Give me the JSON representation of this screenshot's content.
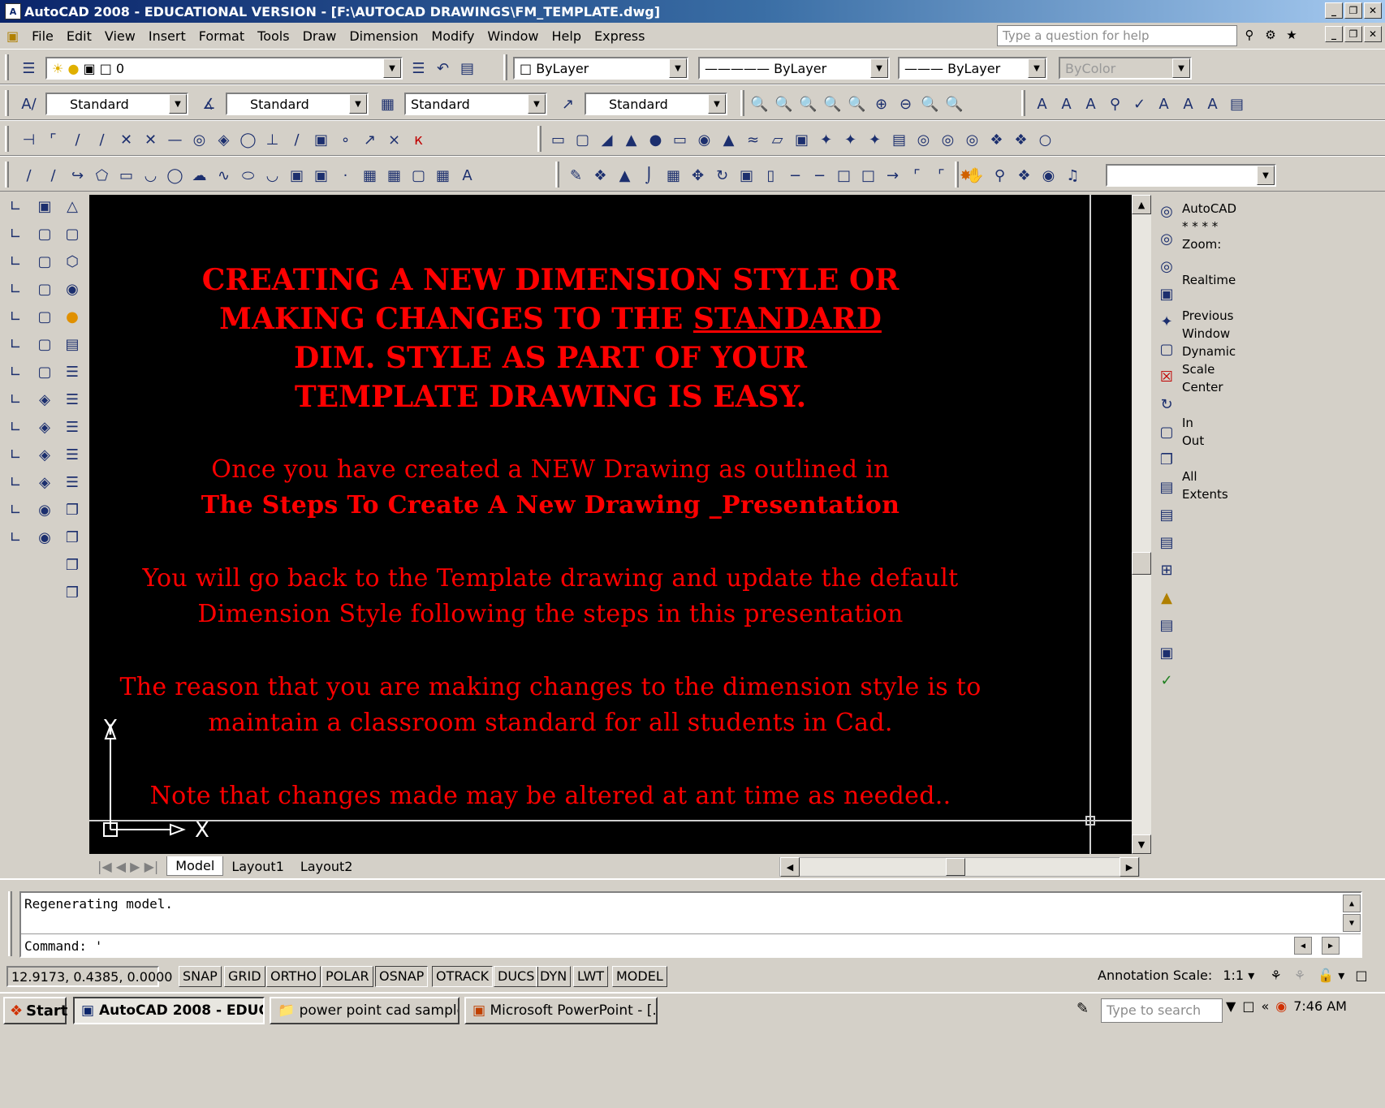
{
  "window": {
    "title": "AutoCAD 2008 - EDUCATIONAL VERSION - [F:\\AUTOCAD DRAWINGS\\FM_TEMPLATE.dwg]",
    "controls": [
      "_",
      "❐",
      "✕"
    ]
  },
  "menu": {
    "items": [
      "File",
      "Edit",
      "View",
      "Insert",
      "Format",
      "Tools",
      "Draw",
      "Dimension",
      "Modify",
      "Window",
      "Help",
      "Express"
    ],
    "help_placeholder": "Type a question for help"
  },
  "toolbar_layers": {
    "layer": "0",
    "color": "ByLayer",
    "linetype": "ByLayer",
    "lineweight": "ByLayer",
    "plotstyle": "ByColor"
  },
  "toolbar_styles": {
    "text_style": "Standard",
    "dim_style": "Standard",
    "table_style": "Standard",
    "mleader_style": "Standard"
  },
  "drawing": {
    "heading": [
      "CREATING A  NEW DIMENSION STYLE  OR",
      "MAKING CHANGES TO THE ",
      "STANDARD",
      "DIM. STYLE AS PART OF YOUR",
      "TEMPLATE  DRAWING IS EASY."
    ],
    "para1_line1": "Once you have created a NEW Drawing as outlined in",
    "para1_line2": "The Steps To Create A New Drawing _Presentation",
    "para2_line1": "You will go back to the Template drawing and update the default",
    "para2_line2": "Dimension  Style  following  the steps  in  this  presentation",
    "para3_line1": "The reason  that you are making changes to the dimension  style  is to",
    "para3_line2": "maintain  a classroom  standard  for all students  in Cad.",
    "para4": "Note that changes made may be altered at ant time as needed..",
    "axis_y": "Y",
    "axis_x": "X",
    "text_color": "#ff0000",
    "background": "#000000"
  },
  "layout_tabs": [
    "Model",
    "Layout1",
    "Layout2"
  ],
  "zoom_panel": {
    "lines": [
      "AutoCAD",
      "* * * *",
      "Zoom:",
      "",
      "Realtime",
      "",
      "Previous",
      "Window",
      "Dynamic",
      "Scale",
      "Center",
      "",
      "In",
      "Out",
      "",
      "All",
      "Extents"
    ]
  },
  "command": {
    "history": "Regenerating model.",
    "prompt": "Command: '"
  },
  "status": {
    "coords": "12.9173, 0.4385, 0.0000",
    "toggles": [
      "SNAP",
      "GRID",
      "ORTHO",
      "POLAR",
      "OSNAP",
      "OTRACK",
      "DUCS",
      "DYN",
      "LWT",
      "MODEL"
    ],
    "annotation_scale_label": "Annotation Scale:",
    "annotation_scale_value": "1:1"
  },
  "taskbar": {
    "start": "Start",
    "tasks": [
      "AutoCAD 2008 - EDUC...",
      "power point cad samples",
      "Microsoft PowerPoint - [..."
    ],
    "search_placeholder": "Type to search",
    "time": "7:46 AM"
  }
}
